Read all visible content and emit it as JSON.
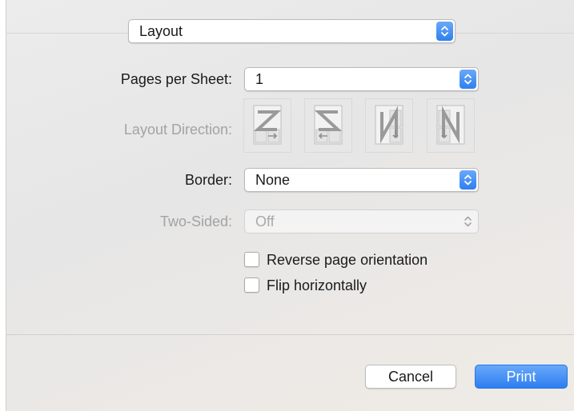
{
  "colors": {
    "accent": "#2e7ef1",
    "disabled_text": "#a3a3a3"
  },
  "section": {
    "value": "Layout",
    "icon": "chevron-updown-icon"
  },
  "pages_per_sheet": {
    "label": "Pages per Sheet:",
    "value": "1"
  },
  "layout_direction": {
    "label": "Layout Direction:",
    "options": [
      {
        "icon": "z-order-icon"
      },
      {
        "icon": "reverse-z-order-icon"
      },
      {
        "icon": "reverse-n-order-icon"
      },
      {
        "icon": "n-order-icon"
      }
    ]
  },
  "border": {
    "label": "Border:",
    "value": "None"
  },
  "two_sided": {
    "label": "Two-Sided:",
    "value": "Off"
  },
  "checkboxes": [
    {
      "label": "Reverse page orientation",
      "checked": false
    },
    {
      "label": "Flip horizontally",
      "checked": false
    }
  ],
  "buttons": {
    "cancel": "Cancel",
    "print": "Print"
  }
}
